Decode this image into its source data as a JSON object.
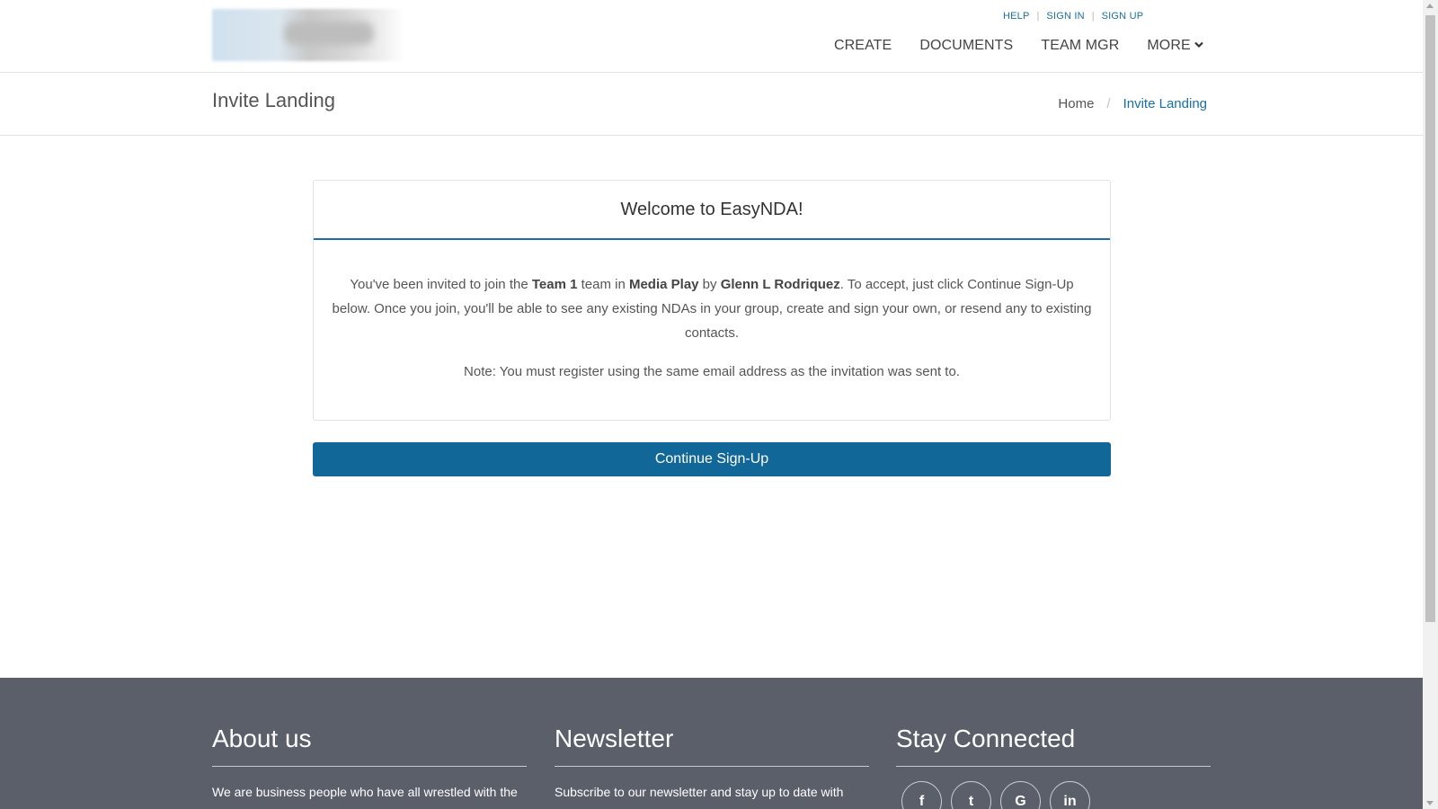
{
  "header": {
    "top_links": {
      "help": "HELP",
      "sign_in": "SIGN IN",
      "sign_up": "SIGN UP"
    },
    "nav": {
      "create": "CREATE",
      "documents": "DOCUMENTS",
      "team_mgr": "TEAM MGR",
      "more": "MORE"
    }
  },
  "subheader": {
    "title": "Invite Landing",
    "breadcrumb": {
      "home": "Home",
      "separator": "/",
      "current": "Invite Landing"
    }
  },
  "card": {
    "title": "Welcome to EasyNDA!",
    "invite": {
      "t1": "You've been invited to join the ",
      "team": "Team 1",
      "t2": " team in ",
      "org": "Media Play",
      "t3": " by ",
      "inviter": "Glenn L Rodriquez",
      "t4": ". To accept, just click Continue Sign-Up below. Once you join, you'll be able to see any existing NDAs in your group, create and sign your own, or resend any to existing contacts."
    },
    "note": "Note: You must register using the same email address as the invitation was sent to."
  },
  "continue_button": "Continue Sign-Up",
  "footer": {
    "about": {
      "title": "About us",
      "text": "We are business people who have all wrestled with the"
    },
    "newsletter": {
      "title": "Newsletter",
      "text": "Subscribe to our newsletter and stay up to date with"
    },
    "stay_connected": {
      "title": "Stay Connected",
      "icons": [
        "facebook-icon",
        "twitter-icon",
        "google-icon",
        "linkedin-icon"
      ],
      "glyphs": {
        "facebook": "f",
        "twitter": "t",
        "google": "G",
        "linkedin": "in"
      }
    }
  },
  "colors": {
    "accent": "#126799",
    "link": "#1a6fa3",
    "footer_bg": "#5a5f6a"
  }
}
